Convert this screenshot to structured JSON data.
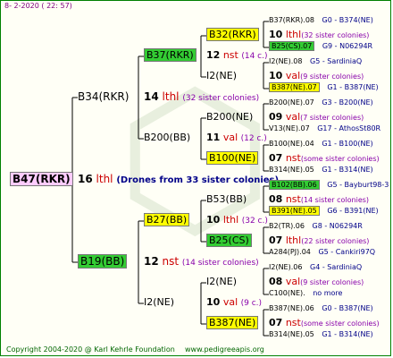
{
  "header": "8-  2-2020 ( 22: 57)",
  "footer": {
    "copyright": "Copyright 2004-2020 @ Karl Kehrle Foundation",
    "url": "www.pedigreeapis.org"
  },
  "root": {
    "name": "B47(RKR)",
    "num": "16",
    "unit": "lthl",
    "note": "(Drones from 33 sister colonies)"
  },
  "level1": [
    {
      "name": "B34(RKR)",
      "num": "14",
      "unit": "lthl",
      "note": "(32 sister colonies)"
    },
    {
      "name": "B19(BB)",
      "num": "12",
      "unit": "nst",
      "note": "(14 sister colonies)"
    }
  ],
  "level2": [
    {
      "name": "B37(RKR)",
      "num": "12",
      "unit": "nst",
      "note": "(14 c.)"
    },
    {
      "name": "B200(BB)",
      "num": "11",
      "unit": "val",
      "note": "(12 c.)"
    },
    {
      "name": "B27(BB)",
      "num": "10",
      "unit": "lthl",
      "note": "(32 c.)"
    },
    {
      "name": "I2(NE)",
      "num": "10",
      "unit": "val",
      "note": "(9 c.)"
    }
  ],
  "level3": [
    {
      "name": "B32(RKR)",
      "num": "10",
      "unit": "lthl",
      "note": "(32 sister colonies)"
    },
    {
      "name": "I2(NE)",
      "num": "10",
      "unit": "val",
      "note": "(9 sister colonies)"
    },
    {
      "name": "B200(NE)",
      "num": "09",
      "unit": "val",
      "note": "(7 sister colonies)"
    },
    {
      "name": "B100(NE)",
      "num": "07",
      "unit": "nst",
      "note": "(some sister colonies)"
    },
    {
      "name": "B53(BB)",
      "num": "08",
      "unit": "nst",
      "note": "(14 sister colonies)"
    },
    {
      "name": "B25(CS)",
      "num": "07",
      "unit": "lthl",
      "note": "(22 sister colonies)"
    },
    {
      "name": "I2(NE)",
      "num": "08",
      "unit": "val",
      "note": "(9 sister colonies)"
    },
    {
      "name": "B387(NE)",
      "num": "07",
      "unit": "nst",
      "note": "(some sister colonies)"
    }
  ],
  "level4": [
    {
      "name": "B37(RKR).08",
      "info": "G0 - B374(NE)"
    },
    {
      "name": "B25(CS).07",
      "info": "G9 - N06294R"
    },
    {
      "name": "I2(NE).08",
      "info": "G5 - SardiniaQ"
    },
    {
      "name": "B387(NE).07",
      "info": "G1 - B387(NE)"
    },
    {
      "name": "B200(NE).07",
      "info": "G3 - B200(NE)"
    },
    {
      "name": "V13(NE).07",
      "info": "G17 - AthosSt80R"
    },
    {
      "name": "B100(NE).04",
      "info": "G1 - B100(NE)"
    },
    {
      "name": "B314(NE).05",
      "info": "G1 - B314(NE)"
    },
    {
      "name": "B102(BB).06",
      "info": "G5 - Bayburt98-3"
    },
    {
      "name": "B391(NE).05",
      "info": "G6 - B391(NE)"
    },
    {
      "name": "B2(TR).06",
      "info": "G8 - N06294R"
    },
    {
      "name": "A284(PJ).04",
      "info": "G5 - Cankiri97Q"
    },
    {
      "name": "I2(NE).06",
      "info": "G4 - SardiniaQ"
    },
    {
      "name": "C100(NE).",
      "info": "no more"
    },
    {
      "name": "B387(NE).06",
      "info": "G0 - B387(NE)"
    },
    {
      "name": "B314(NE).05",
      "info": "G1 - B314(NE)"
    }
  ]
}
